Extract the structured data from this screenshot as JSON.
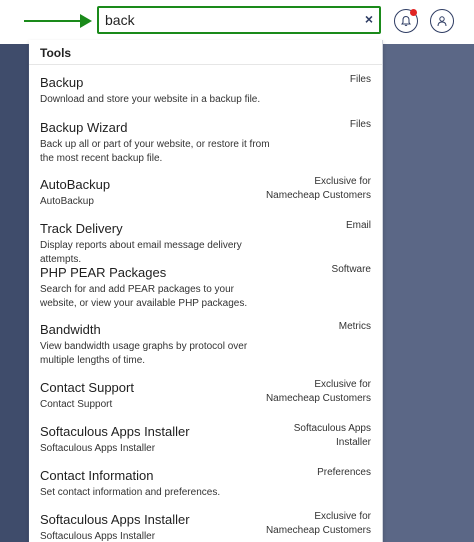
{
  "search": {
    "value": "back",
    "clear_label": "×"
  },
  "header": {
    "notifications_icon": "bell-icon",
    "account_icon": "user-icon",
    "notification_dot_color": "#e02424"
  },
  "dropdown": {
    "section_title": "Tools",
    "items": [
      {
        "title": "Backup",
        "desc": "Download and store your website in a backup file.",
        "cat": "Files"
      },
      {
        "title": "Backup Wizard",
        "desc": "Back up all or part of your website, or restore it from the most recent backup file.",
        "cat": "Files"
      },
      {
        "title": "AutoBackup",
        "desc": "AutoBackup",
        "cat": "Exclusive for Namecheap Customers"
      },
      {
        "title": "Track Delivery",
        "desc": "Display reports about email message delivery attempts.",
        "cat": "Email"
      },
      {
        "title": "PHP PEAR Packages",
        "desc": "Search for and add PEAR packages to your website, or view your available PHP packages.",
        "cat": "Software"
      },
      {
        "title": "Bandwidth",
        "desc": "View bandwidth usage graphs by protocol over multiple lengths of time.",
        "cat": "Metrics"
      },
      {
        "title": "Contact Support",
        "desc": "Contact Support",
        "cat": "Exclusive for Namecheap Customers"
      },
      {
        "title": "Softaculous Apps Installer",
        "desc": "Softaculous Apps Installer",
        "cat": "Softaculous Apps Installer"
      },
      {
        "title": "Contact Information",
        "desc": "Set contact information and preferences.",
        "cat": "Preferences"
      },
      {
        "title": "Softaculous Apps Installer",
        "desc": "Softaculous Apps Installer",
        "cat": "Exclusive for Namecheap Customers"
      }
    ]
  }
}
